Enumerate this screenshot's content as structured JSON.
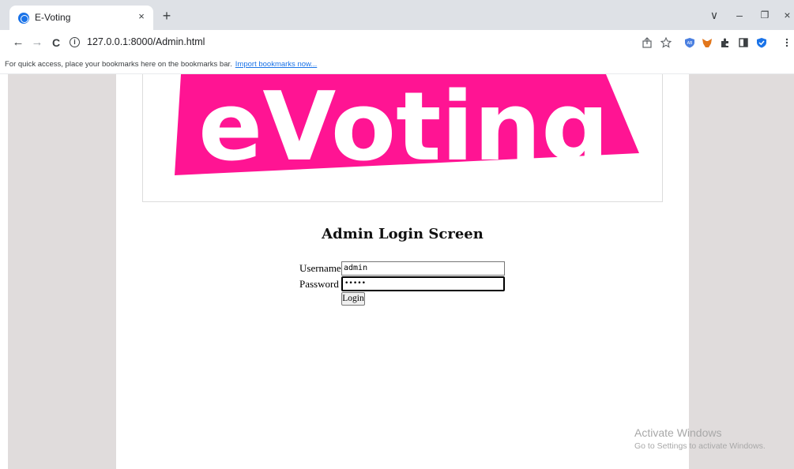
{
  "browser": {
    "tab": {
      "title": "E-Voting",
      "close_glyph": "×"
    },
    "new_tab_glyph": "+",
    "window_controls": {
      "tab_search": "∨",
      "minimize": "–",
      "restore": "❐",
      "close": "×"
    },
    "nav": {
      "back": "←",
      "forward": "→",
      "reload": "C"
    },
    "address": {
      "url": "127.0.0.1:8000/Admin.html"
    },
    "bookmarks_bar": {
      "message": "For quick access, place your bookmarks here on the bookmarks bar.",
      "import_link": "Import bookmarks now..."
    }
  },
  "page": {
    "logo_text": "eVoting",
    "heading": "Admin Login Screen",
    "username_label": "Username",
    "username_value": "admin",
    "password_label": "Password",
    "password_mask": "•••••",
    "login_label": "Login"
  },
  "os_watermark": {
    "title": "Activate Windows",
    "subtitle": "Go to Settings to activate Windows."
  },
  "colors": {
    "logo_pink": "#ff1493",
    "side_panel": "#e0dcdc",
    "tab_strip": "#dee1e6",
    "link": "#1a73e8"
  }
}
